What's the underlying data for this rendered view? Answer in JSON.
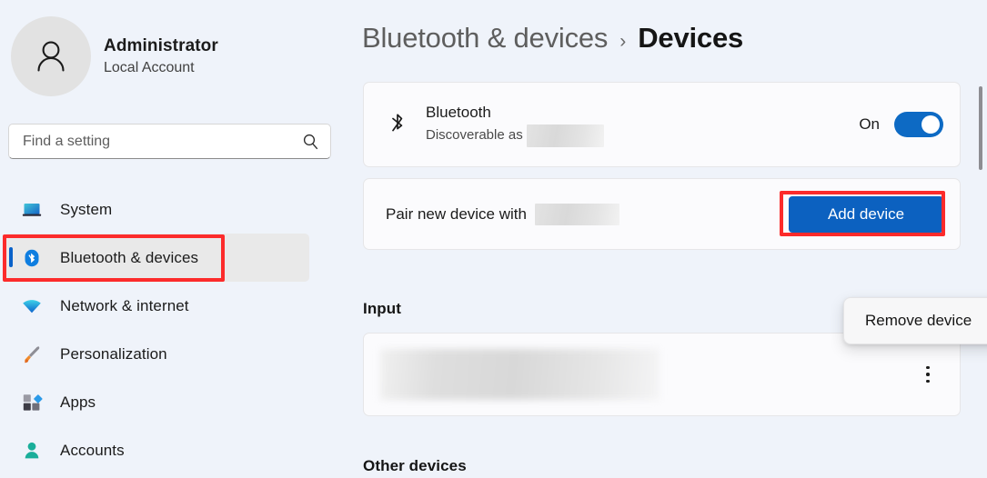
{
  "account": {
    "name": "Administrator",
    "subtitle": "Local Account",
    "avatar_icon": "person-icon"
  },
  "search": {
    "placeholder": "Find a setting",
    "icon": "search-icon"
  },
  "sidebar": {
    "items": [
      {
        "label": "System",
        "icon": "system-icon",
        "selected": false
      },
      {
        "label": "Bluetooth & devices",
        "icon": "bluetooth-icon",
        "selected": true
      },
      {
        "label": "Network & internet",
        "icon": "network-icon",
        "selected": false
      },
      {
        "label": "Personalization",
        "icon": "personalization-icon",
        "selected": false
      },
      {
        "label": "Apps",
        "icon": "apps-icon",
        "selected": false
      },
      {
        "label": "Accounts",
        "icon": "accounts-icon",
        "selected": false
      }
    ]
  },
  "breadcrumb": {
    "parent": "Bluetooth & devices",
    "separator": "›",
    "current": "Devices"
  },
  "bluetooth_card": {
    "icon": "bluetooth-glyph-icon",
    "title": "Bluetooth",
    "subtitle_prefix": "Discoverable as",
    "subtitle_value_redacted": true,
    "toggle_state_label": "On",
    "toggle_on": true
  },
  "pair_card": {
    "label": "Pair new device with",
    "device_name_redacted": true,
    "button_label": "Add device"
  },
  "sections": {
    "input_heading": "Input",
    "other_devices_heading": "Other devices"
  },
  "input_card": {
    "device_name_blurred": true,
    "menu_icon": "kebab-menu-icon"
  },
  "flyout": {
    "label": "Remove device"
  },
  "annotations": {
    "color": "#fc2b2b",
    "targets": [
      "sidebar-item-bluetooth-devices",
      "add-device-button"
    ]
  },
  "colors": {
    "accent": "#0c61c0",
    "page_background": "#eff3fa",
    "card_background": "#fbfbfd",
    "selected_nav_background": "#e9e9e9",
    "annotation_red": "#fc2b2b"
  }
}
